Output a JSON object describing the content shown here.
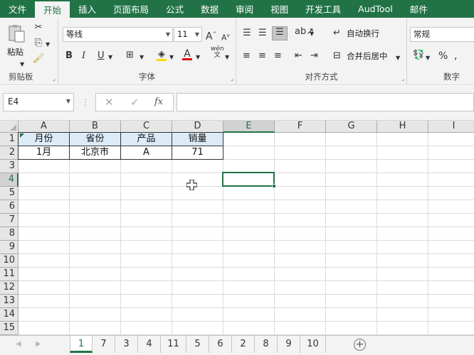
{
  "ribbon_tabs": [
    {
      "label": "文件"
    },
    {
      "label": "开始"
    },
    {
      "label": "插入"
    },
    {
      "label": "页面布局"
    },
    {
      "label": "公式"
    },
    {
      "label": "数据"
    },
    {
      "label": "审阅"
    },
    {
      "label": "视图"
    },
    {
      "label": "开发工具"
    },
    {
      "label": "AudTool"
    },
    {
      "label": "邮件"
    }
  ],
  "active_tab": "开始",
  "clipboard": {
    "paste_label": "粘贴",
    "group_label": "剪贴板"
  },
  "font": {
    "name": "等线",
    "size": "11",
    "group_label": "字体",
    "bold": "B",
    "italic": "I",
    "underline": "U",
    "grow": "A",
    "shrink": "A",
    "color_letter": "A",
    "phonetic": "wén"
  },
  "alignment": {
    "wrap_text": "自动换行",
    "merge_center": "合并后居中",
    "group_label": "对齐方式"
  },
  "number": {
    "format": "常规",
    "group_label": "数字",
    "percent": "%"
  },
  "formula_bar": {
    "name_box": "E4",
    "cancel": "✕",
    "enter": "✓",
    "fx": "fx",
    "formula": ""
  },
  "columns": [
    "A",
    "B",
    "C",
    "D",
    "E",
    "F",
    "G",
    "H",
    "I"
  ],
  "rows": [
    "1",
    "2",
    "3",
    "4",
    "5",
    "6",
    "7",
    "8",
    "9",
    "10",
    "11",
    "12",
    "13",
    "14",
    "15"
  ],
  "selected_cell": "E4",
  "table": {
    "headers": [
      "月份",
      "省份",
      "产品",
      "销量"
    ],
    "rows": [
      [
        "1月",
        "北京市",
        "A",
        "71"
      ]
    ]
  },
  "sheet_tabs": [
    "1",
    "7",
    "3",
    "4",
    "11",
    "5",
    "6",
    "2",
    "8",
    "9",
    "10"
  ],
  "active_sheet": "1",
  "colors": {
    "accent": "#217346",
    "header_fill": "#ddebf7",
    "font_color_bar": "#e00000",
    "fill_color_bar": "#ffd700"
  }
}
